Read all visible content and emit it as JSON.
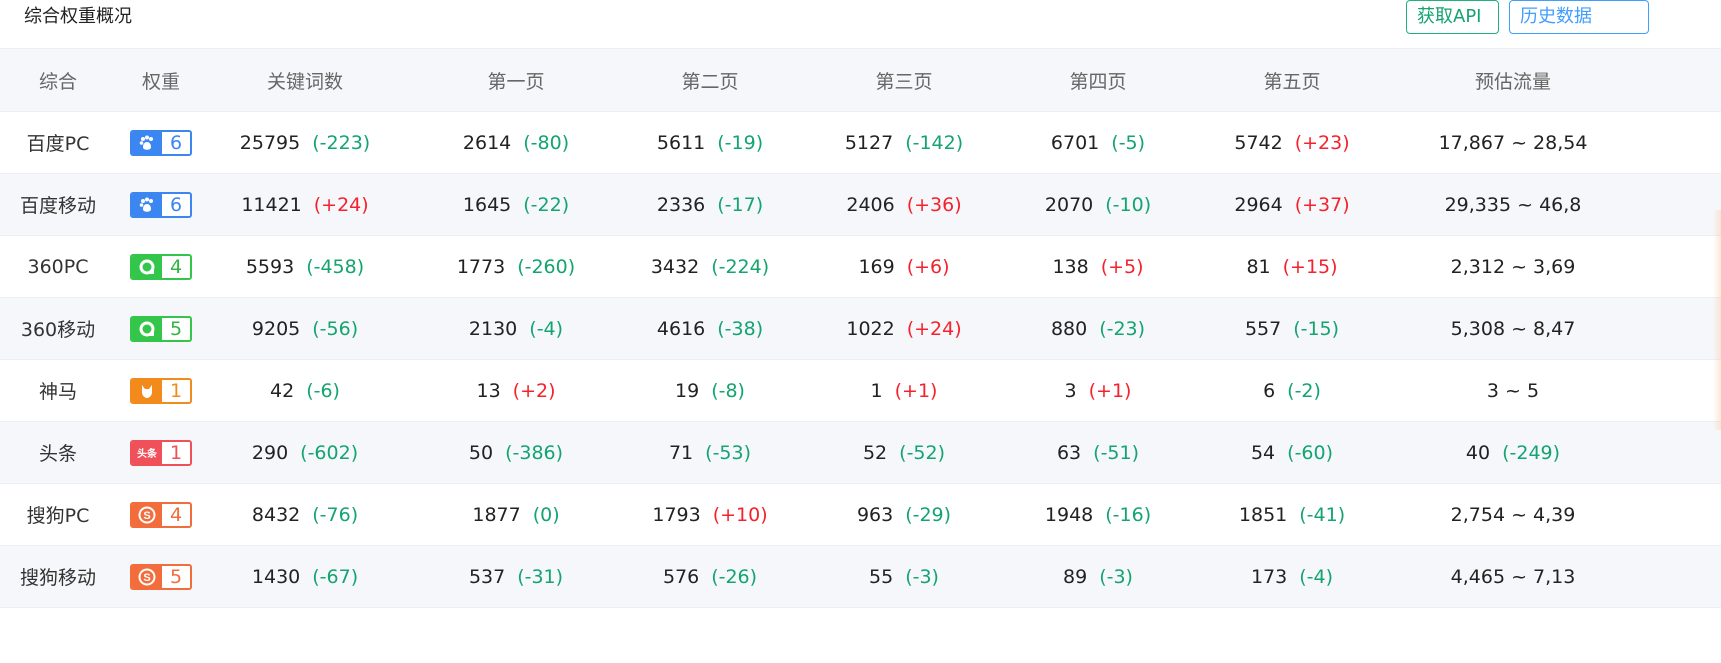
{
  "header": {
    "title": "综合权重概况",
    "api_button": "获取API",
    "history_button": "历史数据"
  },
  "columns": [
    "综合",
    "权重",
    "关键词数",
    "第一页",
    "第二页",
    "第三页",
    "第四页",
    "第五页",
    "预估流量"
  ],
  "colors": {
    "increase": "#f5222d",
    "decrease": "#13a46f",
    "accent": "#1fb07b"
  },
  "rows": [
    {
      "engine": "百度PC",
      "icon": "baidu-paw-icon",
      "weight": "6",
      "keywords": {
        "value": "25795",
        "delta": "(-223)"
      },
      "p1": {
        "value": "2614",
        "delta": "(-80)"
      },
      "p2": {
        "value": "5611",
        "delta": "(-19)"
      },
      "p3": {
        "value": "5127",
        "delta": "(-142)"
      },
      "p4": {
        "value": "6701",
        "delta": "(-5)"
      },
      "p5": {
        "value": "5742",
        "delta": "(+23)"
      },
      "traffic": {
        "value": "17,867 ~ 28,54",
        "delta": ""
      }
    },
    {
      "engine": "百度移动",
      "icon": "baidu-paw-mobile-icon",
      "weight": "6",
      "keywords": {
        "value": "11421",
        "delta": "(+24)"
      },
      "p1": {
        "value": "1645",
        "delta": "(-22)"
      },
      "p2": {
        "value": "2336",
        "delta": "(-17)"
      },
      "p3": {
        "value": "2406",
        "delta": "(+36)"
      },
      "p4": {
        "value": "2070",
        "delta": "(-10)"
      },
      "p5": {
        "value": "2964",
        "delta": "(+37)"
      },
      "traffic": {
        "value": "29,335 ~ 46,8",
        "delta": ""
      }
    },
    {
      "engine": "360PC",
      "icon": "360-search-icon",
      "weight": "4",
      "keywords": {
        "value": "5593",
        "delta": "(-458)"
      },
      "p1": {
        "value": "1773",
        "delta": "(-260)"
      },
      "p2": {
        "value": "3432",
        "delta": "(-224)"
      },
      "p3": {
        "value": "169",
        "delta": "(+6)"
      },
      "p4": {
        "value": "138",
        "delta": "(+5)"
      },
      "p5": {
        "value": "81",
        "delta": "(+15)"
      },
      "traffic": {
        "value": "2,312 ~ 3,69",
        "delta": ""
      }
    },
    {
      "engine": "360移动",
      "icon": "360-search-icon",
      "weight": "5",
      "keywords": {
        "value": "9205",
        "delta": "(-56)"
      },
      "p1": {
        "value": "2130",
        "delta": "(-4)"
      },
      "p2": {
        "value": "4616",
        "delta": "(-38)"
      },
      "p3": {
        "value": "1022",
        "delta": "(+24)"
      },
      "p4": {
        "value": "880",
        "delta": "(-23)"
      },
      "p5": {
        "value": "557",
        "delta": "(-15)"
      },
      "traffic": {
        "value": "5,308 ~ 8,47",
        "delta": ""
      }
    },
    {
      "engine": "神马",
      "icon": "shenma-horse-icon",
      "weight": "1",
      "keywords": {
        "value": "42",
        "delta": "(-6)"
      },
      "p1": {
        "value": "13",
        "delta": "(+2)"
      },
      "p2": {
        "value": "19",
        "delta": "(-8)"
      },
      "p3": {
        "value": "1",
        "delta": "(+1)"
      },
      "p4": {
        "value": "3",
        "delta": "(+1)"
      },
      "p5": {
        "value": "6",
        "delta": "(-2)"
      },
      "traffic": {
        "value": "3 ~ 5",
        "delta": ""
      }
    },
    {
      "engine": "头条",
      "icon": "toutiao-icon",
      "icon_text": "头条",
      "weight": "1",
      "keywords": {
        "value": "290",
        "delta": "(-602)"
      },
      "p1": {
        "value": "50",
        "delta": "(-386)"
      },
      "p2": {
        "value": "71",
        "delta": "(-53)"
      },
      "p3": {
        "value": "52",
        "delta": "(-52)"
      },
      "p4": {
        "value": "63",
        "delta": "(-51)"
      },
      "p5": {
        "value": "54",
        "delta": "(-60)"
      },
      "traffic": {
        "value": "40",
        "delta": "(-249)"
      }
    },
    {
      "engine": "搜狗PC",
      "icon": "sogou-s-icon",
      "weight": "4",
      "keywords": {
        "value": "8432",
        "delta": "(-76)"
      },
      "p1": {
        "value": "1877",
        "delta": "(0)"
      },
      "p2": {
        "value": "1793",
        "delta": "(+10)"
      },
      "p3": {
        "value": "963",
        "delta": "(-29)"
      },
      "p4": {
        "value": "1948",
        "delta": "(-16)"
      },
      "p5": {
        "value": "1851",
        "delta": "(-41)"
      },
      "traffic": {
        "value": "2,754 ~ 4,39",
        "delta": ""
      }
    },
    {
      "engine": "搜狗移动",
      "icon": "sogou-s-icon",
      "weight": "5",
      "keywords": {
        "value": "1430",
        "delta": "(-67)"
      },
      "p1": {
        "value": "537",
        "delta": "(-31)"
      },
      "p2": {
        "value": "576",
        "delta": "(-26)"
      },
      "p3": {
        "value": "55",
        "delta": "(-3)"
      },
      "p4": {
        "value": "89",
        "delta": "(-3)"
      },
      "p5": {
        "value": "173",
        "delta": "(-4)"
      },
      "traffic": {
        "value": "4,465 ~ 7,13",
        "delta": ""
      }
    }
  ]
}
